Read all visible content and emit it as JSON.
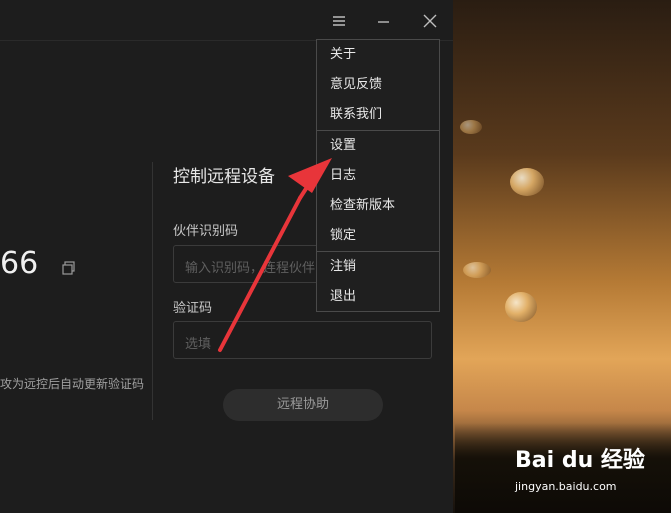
{
  "app": {
    "window": {
      "menu_icon": "hamburger-icon",
      "minimize_icon": "minimize-icon",
      "close_icon": "close-icon"
    },
    "left": {
      "code": "66",
      "copy_icon": "copy-icon",
      "note": "攻为远控后自动更新验证码"
    },
    "control": {
      "title": "控制远程设备",
      "partner_id_label": "伙伴识别码",
      "partner_id_placeholder": "输入识别码，连程伙伴",
      "verify_label": "验证码",
      "verify_placeholder": "选填",
      "remote_button": "远程协助"
    },
    "menu": {
      "items": [
        {
          "label": "关于"
        },
        {
          "label": "意见反馈"
        },
        {
          "label": "联系我们"
        },
        {
          "label": "设置"
        },
        {
          "label": "日志"
        },
        {
          "label": "检查新版本"
        },
        {
          "label": "锁定"
        },
        {
          "label": "注销"
        },
        {
          "label": "退出"
        }
      ]
    }
  },
  "watermark": {
    "logo": "Bai du 经验",
    "sub": "jingyan.baidu.com"
  }
}
